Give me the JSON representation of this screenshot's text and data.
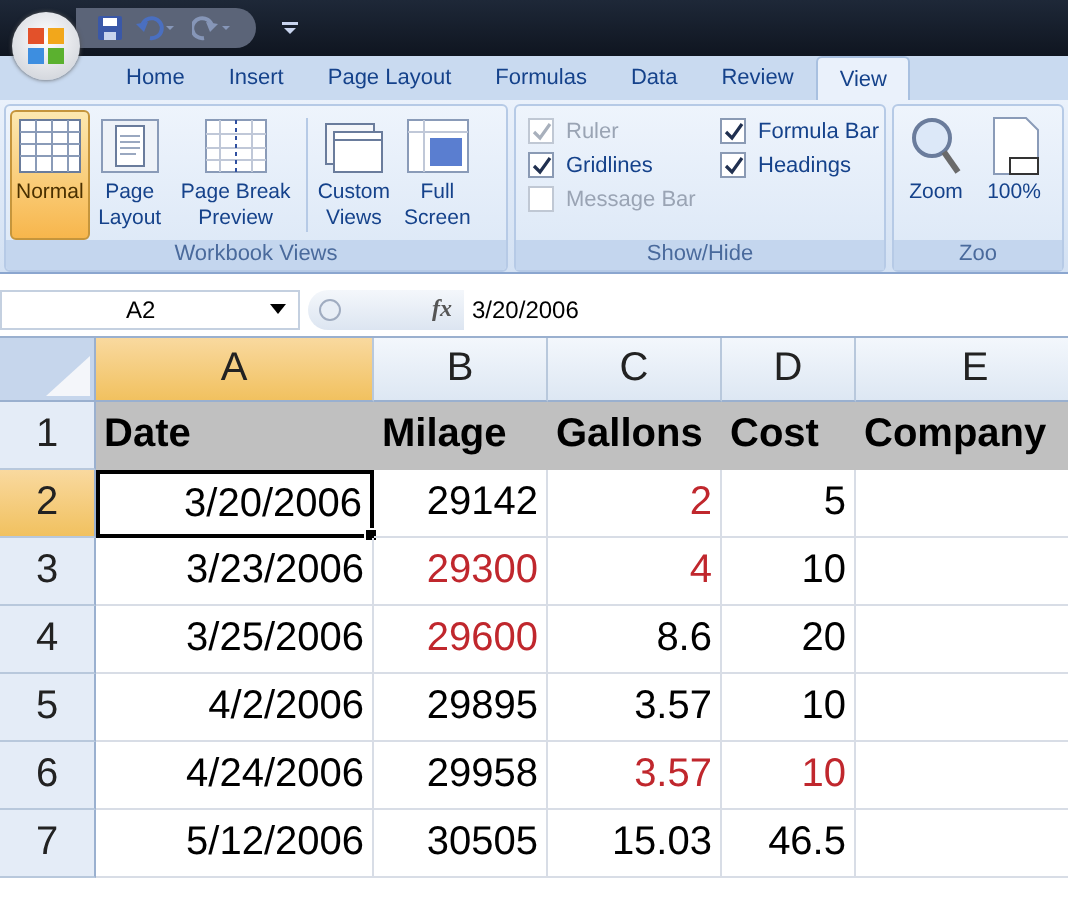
{
  "tabs": [
    {
      "label": "Home",
      "selected": false
    },
    {
      "label": "Insert",
      "selected": false
    },
    {
      "label": "Page Layout",
      "selected": false
    },
    {
      "label": "Formulas",
      "selected": false
    },
    {
      "label": "Data",
      "selected": false
    },
    {
      "label": "Review",
      "selected": false
    },
    {
      "label": "View",
      "selected": true
    }
  ],
  "ribbon": {
    "groups": [
      {
        "kind": "buttons",
        "label": "Workbook Views",
        "buttons": [
          {
            "kind": "normal",
            "label": "Normal",
            "selected": true
          },
          {
            "kind": "page",
            "label": "Page Layout",
            "selected": false
          },
          {
            "kind": "pagebreak",
            "label": "Page Break Preview",
            "selected": false
          },
          {
            "kind": "custom",
            "label": "Custom Views",
            "selected": false
          },
          {
            "kind": "full",
            "label": "Full Screen",
            "selected": false
          }
        ]
      },
      {
        "kind": "checks",
        "label": "Show/Hide",
        "checks": [
          {
            "label": "Ruler",
            "checked": true,
            "disabled": true
          },
          {
            "label": "Formula Bar",
            "checked": true,
            "disabled": false
          },
          {
            "label": "Gridlines",
            "checked": true,
            "disabled": false
          },
          {
            "label": "Headings",
            "checked": true,
            "disabled": false
          },
          {
            "label": "Message Bar",
            "checked": false,
            "disabled": true
          }
        ]
      },
      {
        "kind": "buttons",
        "label": "Zoo",
        "buttons": [
          {
            "kind": "zoom",
            "label": "Zoom",
            "selected": false
          },
          {
            "kind": "hundred",
            "label": "100%",
            "selected": false
          }
        ]
      }
    ]
  },
  "formula_bar": {
    "name_box": "A2",
    "fx_label": "fx",
    "value": "3/20/2006"
  },
  "sheet": {
    "columns": [
      {
        "label": "A",
        "selected": true
      },
      {
        "label": "B",
        "selected": false
      },
      {
        "label": "C",
        "selected": false
      },
      {
        "label": "D",
        "selected": false
      },
      {
        "label": "E",
        "selected": false
      }
    ],
    "rows": [
      {
        "label": "1",
        "selected": false,
        "kind": "header",
        "cells": [
          {
            "text": "Date",
            "color": "#000000",
            "active": false
          },
          {
            "text": "Milage",
            "color": "#000000",
            "active": false
          },
          {
            "text": "Gallons",
            "color": "#000000",
            "active": false
          },
          {
            "text": "Cost",
            "color": "#000000",
            "active": false
          },
          {
            "text": "Company",
            "color": "#000000",
            "active": false
          }
        ]
      },
      {
        "label": "2",
        "selected": true,
        "kind": "data",
        "cells": [
          {
            "text": "3/20/2006",
            "color": "#000000",
            "active": true
          },
          {
            "text": "29142",
            "color": "#000000",
            "active": false
          },
          {
            "text": "2",
            "color": "#c0272d",
            "active": false
          },
          {
            "text": "5",
            "color": "#000000",
            "active": false
          }
        ]
      },
      {
        "label": "3",
        "selected": false,
        "kind": "data",
        "cells": [
          {
            "text": "3/23/2006",
            "color": "#000000",
            "active": false
          },
          {
            "text": "29300",
            "color": "#c0272d",
            "active": false
          },
          {
            "text": "4",
            "color": "#c0272d",
            "active": false
          },
          {
            "text": "10",
            "color": "#000000",
            "active": false
          }
        ]
      },
      {
        "label": "4",
        "selected": false,
        "kind": "data",
        "cells": [
          {
            "text": "3/25/2006",
            "color": "#000000",
            "active": false
          },
          {
            "text": "29600",
            "color": "#c0272d",
            "active": false
          },
          {
            "text": "8.6",
            "color": "#000000",
            "active": false
          },
          {
            "text": "20",
            "color": "#000000",
            "active": false
          }
        ]
      },
      {
        "label": "5",
        "selected": false,
        "kind": "data",
        "cells": [
          {
            "text": "4/2/2006",
            "color": "#000000",
            "active": false
          },
          {
            "text": "29895",
            "color": "#000000",
            "active": false
          },
          {
            "text": "3.57",
            "color": "#000000",
            "active": false
          },
          {
            "text": "10",
            "color": "#000000",
            "active": false
          }
        ]
      },
      {
        "label": "6",
        "selected": false,
        "kind": "data",
        "cells": [
          {
            "text": "4/24/2006",
            "color": "#000000",
            "active": false
          },
          {
            "text": "29958",
            "color": "#000000",
            "active": false
          },
          {
            "text": "3.57",
            "color": "#c0272d",
            "active": false
          },
          {
            "text": "10",
            "color": "#c0272d",
            "active": false
          }
        ]
      },
      {
        "label": "7",
        "selected": false,
        "kind": "data",
        "cells": [
          {
            "text": "5/12/2006",
            "color": "#000000",
            "active": false
          },
          {
            "text": "30505",
            "color": "#000000",
            "active": false
          },
          {
            "text": "15.03",
            "color": "#000000",
            "active": false
          },
          {
            "text": "46.5",
            "color": "#000000",
            "active": false
          }
        ]
      }
    ]
  }
}
